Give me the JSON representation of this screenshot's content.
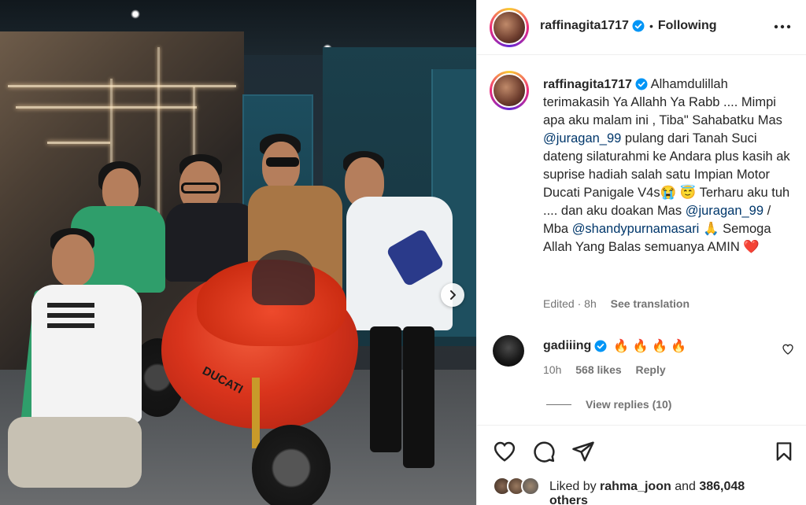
{
  "post": {
    "username": "raffinagita1717",
    "follow_status": "Following",
    "separator": "•",
    "caption_pre": "Alhamdulillah terimakasih Ya Allahh Ya Rabb .... Mimpi apa aku malam ini , Tiba\" Sahabatku Mas ",
    "mention_1": "@juragan_99",
    "caption_mid": " pulang dari Tanah Suci dateng silaturahmi ke Andara plus kasih ak suprise hadiah salah satu Impian Motor Ducati Panigale V4s",
    "emoji_1": "😭",
    "emoji_2": "😇",
    "caption_mid2": " Terharu aku tuh .... dan aku doakan Mas ",
    "mention_2": "@juragan_99",
    "caption_mid3": " / Mba ",
    "mention_3": "@shandypurnamasari",
    "emoji_3": "🙏",
    "caption_end": " Semoga Allah Yang Balas semuanya AMIN ",
    "emoji_4": "❤️",
    "edited": "Edited",
    "time": "8h",
    "see_translation": "See translation"
  },
  "photo": {
    "bike_brand": "DUCATI"
  },
  "comment": {
    "username": "gadiiing",
    "emojis": "🔥 🔥 🔥 🔥",
    "time": "10h",
    "likes": "568 likes",
    "reply": "Reply",
    "view_replies": "View replies (10)"
  },
  "likes": {
    "prefix": "Liked by",
    "user": "rahma_joon",
    "middle": "and",
    "count": "386,048",
    "suffix": "others"
  },
  "icons": {
    "verified": "verified-badge-icon",
    "more": "more-horizontal-icon",
    "like": "heart-icon",
    "comment": "comment-icon",
    "share": "paper-plane-icon",
    "save": "bookmark-icon",
    "next": "chevron-right-icon"
  },
  "colors": {
    "verified": "#0095f6",
    "link": "#00376b",
    "muted": "#737373",
    "heart_red": "#ed4956"
  }
}
